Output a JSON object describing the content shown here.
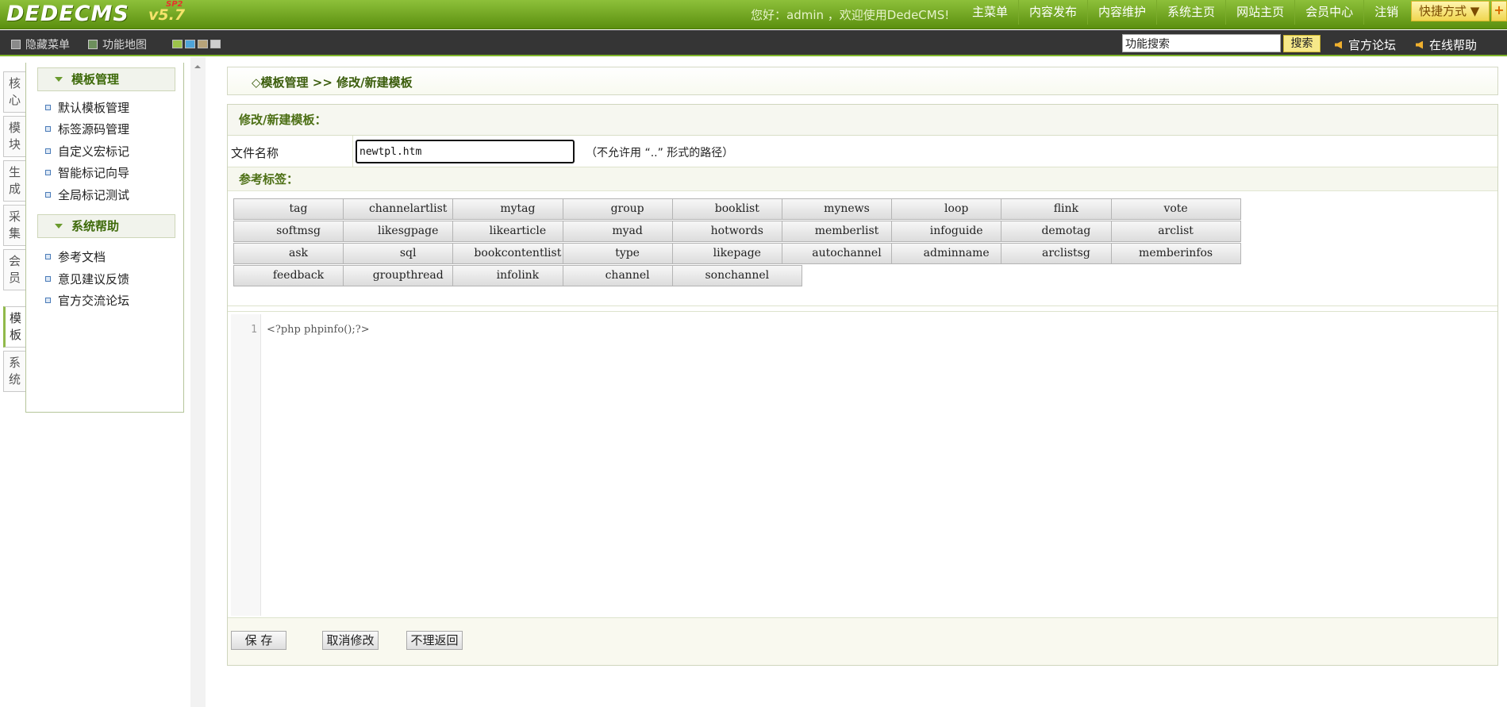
{
  "header": {
    "logo": "DEDECMS",
    "version": "v5.7",
    "edition": "SP2",
    "greeting": "您好：admin ，欢迎使用DedeCMS!",
    "nav": [
      "主菜单",
      "内容发布",
      "内容维护",
      "系统主页",
      "网站主页",
      "会员中心",
      "注销"
    ],
    "quick": "快捷方式 ▼",
    "quick_plus": "+"
  },
  "subbar": {
    "hide_menu": "隐藏菜单",
    "site_map": "功能地图",
    "swatch_colors": [
      "#9cc34a",
      "#4fa4d8",
      "#b8a47a",
      "#cfcfcf"
    ],
    "search_value": "功能搜索",
    "search_btn": "搜索",
    "forum": "官方论坛",
    "help": "在线帮助"
  },
  "vtabs": [
    "核心",
    "模块",
    "生成",
    "采集",
    "会员",
    "模板",
    "系统"
  ],
  "leftmenu": {
    "group1": "模板管理",
    "items1": [
      "默认模板管理",
      "标签源码管理",
      "自定义宏标记",
      "智能标记向导",
      "全局标记测试"
    ],
    "group2": "系统帮助",
    "items2": [
      "参考文档",
      "意见建议反馈",
      "官方交流论坛"
    ]
  },
  "main": {
    "breadcrumb": "◇模板管理 >> 修改/新建模板",
    "form_title": "修改/新建模板：",
    "file_label": "文件名称",
    "file_value": "newtpl.htm",
    "file_hint": "（不允许用 “..” 形式的路径）",
    "ref_title": "参考标签：",
    "tags": [
      "tag",
      "channelartlist",
      "mytag",
      "group",
      "booklist",
      "mynews",
      "loop",
      "flink",
      "vote",
      "softmsg",
      "likesgpage",
      "likearticle",
      "myad",
      "hotwords",
      "memberlist",
      "infoguide",
      "demotag",
      "arclist",
      "ask",
      "sql",
      "bookcontentlist",
      "type",
      "likepage",
      "autochannel",
      "adminname",
      "arclistsg",
      "memberinfos",
      "feedback",
      "groupthread",
      "infolink",
      "channel",
      "sonchannel"
    ],
    "code_line_no": "1",
    "code": "<?php phpinfo();?>",
    "btn_save": "保 存",
    "btn_cancel": "取消修改",
    "btn_back": "不理返回"
  }
}
